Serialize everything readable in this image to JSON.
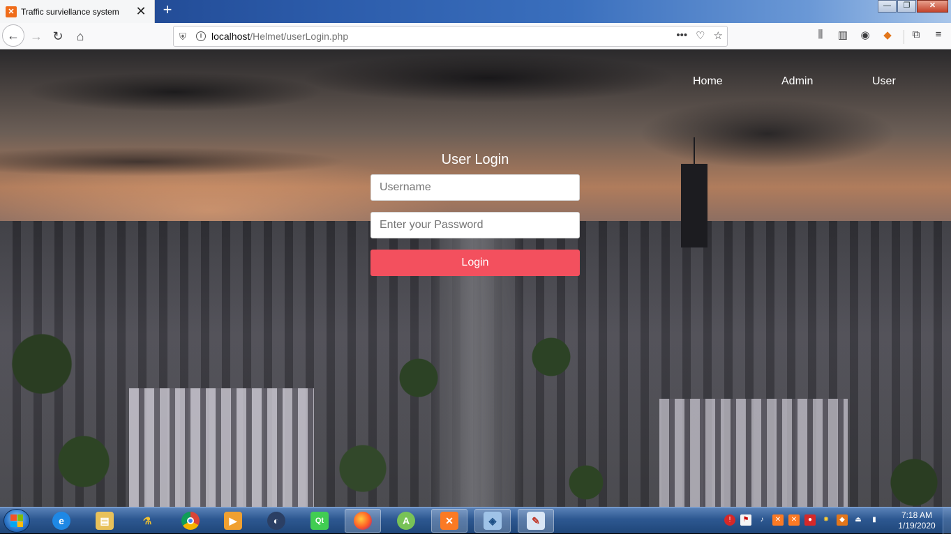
{
  "browser": {
    "tab": {
      "title": "Traffic surviellance system",
      "favicon": "xampp-icon"
    },
    "url": {
      "host": "localhost",
      "path": "/Helmet/userLogin.php"
    }
  },
  "site": {
    "nav": {
      "home": "Home",
      "admin": "Admin",
      "user": "User"
    },
    "login": {
      "title": "User Login",
      "username_placeholder": "Username",
      "password_placeholder": "Enter your Password",
      "button": "Login"
    },
    "colors": {
      "login_button": "#f3505e"
    }
  },
  "taskbar": {
    "apps": [
      "internet-explorer-icon",
      "file-explorer-icon",
      "tool-icon",
      "chrome-icon",
      "media-player-icon",
      "media-center-icon",
      "qt-icon",
      "firefox-icon",
      "android-studio-icon",
      "xampp-icon",
      "virtualbox-icon",
      "paint-icon"
    ],
    "clock": {
      "time": "7:18 AM",
      "date": "1/19/2020"
    }
  }
}
